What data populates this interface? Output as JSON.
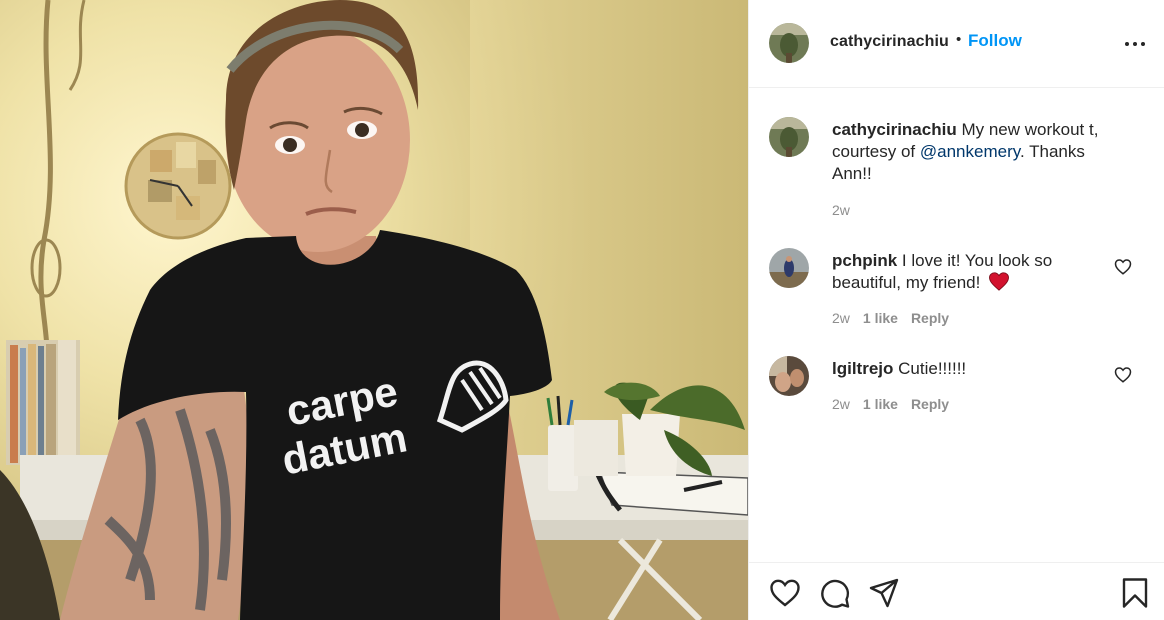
{
  "post": {
    "username": "cathycirinachiu",
    "separator": "•",
    "follow_label": "Follow",
    "more_icon": "more-options-icon",
    "shirt_line1": "carpe",
    "shirt_line2": "datum"
  },
  "caption": {
    "username": "cathycirinachiu",
    "text_before": " My new workout t, courtesy of ",
    "mention": "@annkemery",
    "text_after": ". Thanks Ann!!",
    "time": "2w"
  },
  "comments": [
    {
      "username": "pchpink",
      "text": " I love it! You look so beautiful, my friend! ",
      "emoji": "red-heart-emoji",
      "time": "2w",
      "likes": "1 like",
      "reply_label": "Reply"
    },
    {
      "username": "lgiltrejo",
      "text": " Cutie!!!!!!",
      "time": "2w",
      "likes": "1 like",
      "reply_label": "Reply"
    }
  ],
  "actions": [
    "like-icon",
    "comment-icon",
    "share-icon",
    "save-icon"
  ],
  "colors": {
    "accent": "#0095f6",
    "mention": "#00376b",
    "muted": "#8e8e8e",
    "text": "#262626",
    "heart_red": "#ed4956"
  }
}
